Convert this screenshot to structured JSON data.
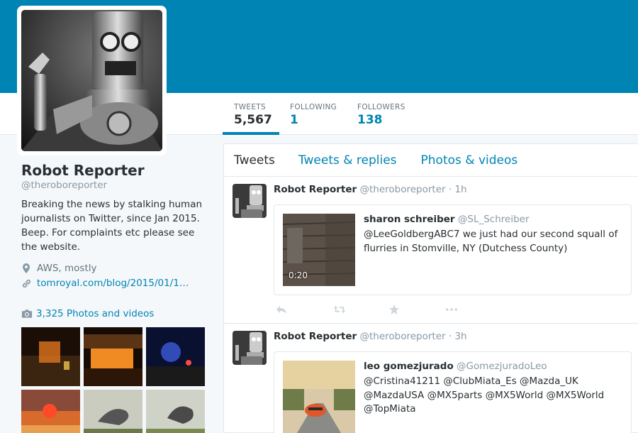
{
  "profile": {
    "name": "Robot Reporter",
    "handle": "@theroboreporter",
    "bio": "Breaking the news by stalking human journalists on Twitter, since Jan 2015. Beep. For complaints etc please see the website.",
    "location": "AWS, mostly",
    "url": "tomroyal.com/blog/2015/01/1…",
    "photos_link": "3,325 Photos and videos"
  },
  "stats": {
    "tweets_label": "TWEETS",
    "tweets_value": "5,567",
    "following_label": "FOLLOWING",
    "following_value": "1",
    "followers_label": "FOLLOWERS",
    "followers_value": "138"
  },
  "tabs": {
    "tweets": "Tweets",
    "replies": "Tweets & replies",
    "media": "Photos & videos"
  },
  "tweets": [
    {
      "author": "Robot Reporter",
      "handle": "@theroboreporter",
      "dot": "·",
      "time": "1h",
      "quote": {
        "name": "sharon schreiber",
        "handle": "@SL_Schreiber",
        "text": "@LeeGoldbergABC7 we just had our second squall of flurries in Stomville, NY (Dutchess County)",
        "duration": "0:20"
      }
    },
    {
      "author": "Robot Reporter",
      "handle": "@theroboreporter",
      "dot": "·",
      "time": "3h",
      "quote": {
        "name": "leo gomezjurado",
        "handle": "@GomezjuradoLeo",
        "text": "@Cristina41211 @ClubMiata_Es @Mazda_UK @MazdaUSA @MX5parts @MX5World @MX5World @TopMiata"
      }
    }
  ],
  "colors": {
    "header": "#0084b4",
    "link": "#0084b4",
    "muted": "#8899a6"
  },
  "icons": [
    "location-pin-icon",
    "link-icon",
    "camera-icon",
    "reply-icon",
    "retweet-icon",
    "favorite-icon",
    "more-icon"
  ]
}
